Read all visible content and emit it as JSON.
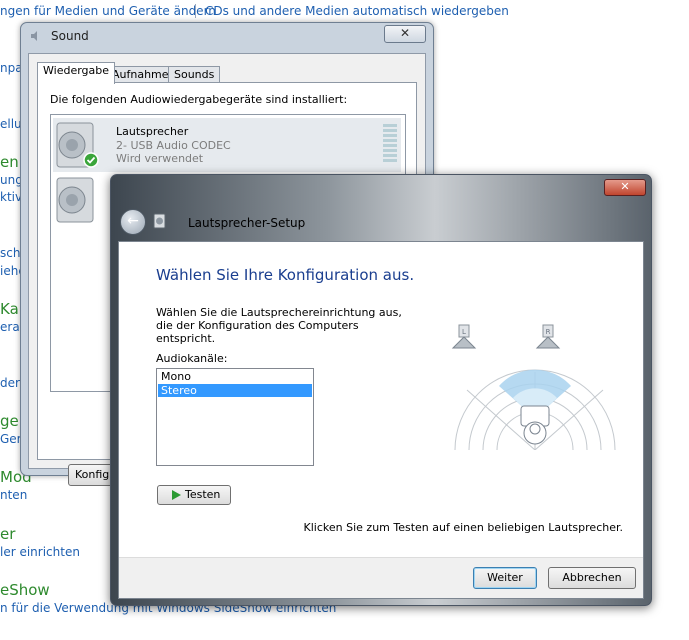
{
  "control_panel": {
    "links": {
      "media_devices": "ngen für Medien und Geräte ändern",
      "cds_autoplay": "CDs und andere Medien automatisch wiedergeben",
      "l1": "npa",
      "l2": "ellu",
      "l3": "ung",
      "l4": "ktiv",
      "l5": "schi",
      "l6": "iehe",
      "l7": "eras",
      "l8": "dern",
      "l9": "Gerä",
      "l10": "nten",
      "l11": "ler einrichten",
      "l12": "n für die Verwendung mit Windows SideShow einrichten"
    },
    "headings": {
      "h1": "en",
      "h2": "Kam",
      "h3": "ger",
      "h4": "Mod",
      "h5": "er",
      "h6": "eShow"
    }
  },
  "sound_dialog": {
    "title": "Sound",
    "close_label": "✕",
    "tabs": [
      {
        "label": "Wiedergabe",
        "active": true
      },
      {
        "label": "Aufnahme",
        "active": false
      },
      {
        "label": "Sounds",
        "active": false
      }
    ],
    "installed_text": "Die folgenden Audiowiedergabegeräte sind installiert:",
    "devices": [
      {
        "name": "Lautsprecher",
        "detail": "2- USB Audio CODEC",
        "status": "Wird verwendet",
        "icon": "speaker-icon",
        "default": true
      }
    ],
    "configure_label": "Konfigurieren"
  },
  "speaker_setup": {
    "title": "Lautsprecher-Setup",
    "close_label": "✕",
    "heading": "Wählen Sie Ihre Konfiguration aus.",
    "description": "Wählen Sie die Lautsprechereinrichtung aus, die der Konfiguration des Computers entspricht.",
    "channels_label": "Audiokanäle:",
    "channels": [
      {
        "label": "Mono",
        "selected": false
      },
      {
        "label": "Stereo",
        "selected": true
      }
    ],
    "test_label": "Testen",
    "hint": "Klicken Sie zum Testen auf einen beliebigen Lautsprecher.",
    "diagram": {
      "left_label": "L",
      "right_label": "R"
    },
    "next_label": "Weiter",
    "cancel_label": "Abbrechen"
  },
  "colors": {
    "link": "#1e5fb0",
    "heading_green": "#2e8a2e",
    "wizard_heading": "#1a3e8f",
    "selection": "#3399ff"
  }
}
